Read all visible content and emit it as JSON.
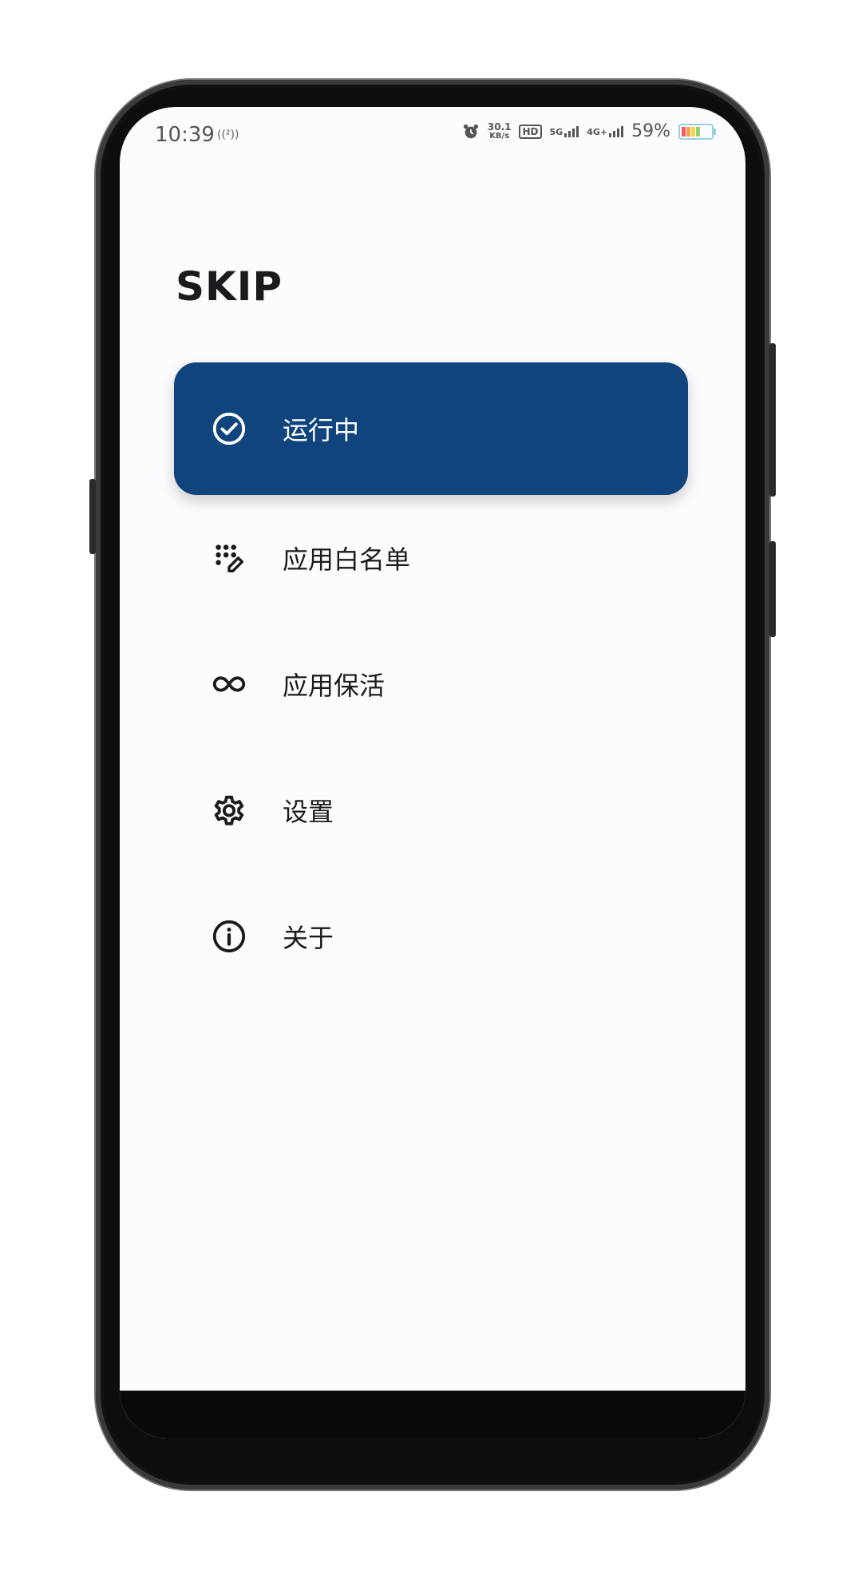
{
  "status_bar": {
    "time": "10:39",
    "nfc": "((²))",
    "speed_value": "30.1",
    "speed_unit": "KB/s",
    "hd": "HD",
    "net_5g": "5G",
    "net_4g": "4G+",
    "battery": "59%"
  },
  "app": {
    "title": "SKIP"
  },
  "nav": {
    "items": [
      {
        "label": "运行中",
        "icon": "check-circle-icon",
        "active": true
      },
      {
        "label": "应用白名单",
        "icon": "dots-edit-icon",
        "active": false
      },
      {
        "label": "应用保活",
        "icon": "infinity-icon",
        "active": false
      },
      {
        "label": "设置",
        "icon": "gear-icon",
        "active": false
      },
      {
        "label": "关于",
        "icon": "info-icon",
        "active": false
      }
    ]
  },
  "colors": {
    "active_bg": "#0f457c",
    "screen_bg": "#fcfbfe",
    "text": "#1b1b1f"
  }
}
